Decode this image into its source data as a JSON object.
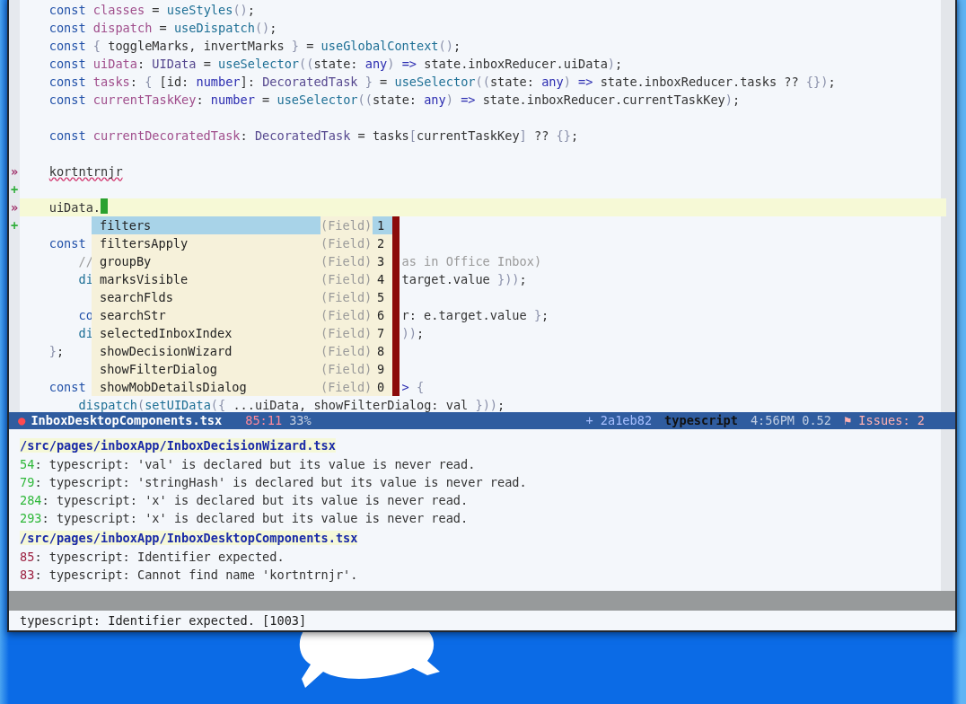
{
  "editor": {
    "lines": [
      {
        "current": false,
        "tokens": [
          {
            "kind": "kw",
            "text": "    const "
          },
          {
            "kind": "var",
            "text": "classes"
          },
          {
            "kind": "plain",
            "text": " = "
          },
          {
            "kind": "fn",
            "text": "useStyles"
          },
          {
            "kind": "punct",
            "text": "()"
          },
          {
            "kind": "plain",
            "text": ";"
          }
        ]
      },
      {
        "current": false,
        "tokens": [
          {
            "kind": "kw",
            "text": "    const "
          },
          {
            "kind": "var",
            "text": "dispatch"
          },
          {
            "kind": "plain",
            "text": " = "
          },
          {
            "kind": "fn",
            "text": "useDispatch"
          },
          {
            "kind": "punct",
            "text": "()"
          },
          {
            "kind": "plain",
            "text": ";"
          }
        ]
      },
      {
        "current": false,
        "tokens": [
          {
            "kind": "kw",
            "text": "    const "
          },
          {
            "kind": "punct",
            "text": "{"
          },
          {
            "kind": "plain",
            "text": " toggleMarks, invertMarks "
          },
          {
            "kind": "punct",
            "text": "}"
          },
          {
            "kind": "plain",
            "text": " = "
          },
          {
            "kind": "fn",
            "text": "useGlobalContext"
          },
          {
            "kind": "punct",
            "text": "()"
          },
          {
            "kind": "plain",
            "text": ";"
          }
        ]
      },
      {
        "current": false,
        "tokens": [
          {
            "kind": "kw",
            "text": "    const "
          },
          {
            "kind": "var",
            "text": "uiData"
          },
          {
            "kind": "plain",
            "text": ": "
          },
          {
            "kind": "type",
            "text": "UIData"
          },
          {
            "kind": "plain",
            "text": " = "
          },
          {
            "kind": "fn",
            "text": "useSelector"
          },
          {
            "kind": "punct",
            "text": "(("
          },
          {
            "kind": "plain",
            "text": "state: "
          },
          {
            "kind": "builtin",
            "text": "any"
          },
          {
            "kind": "punct",
            "text": ") "
          },
          {
            "kind": "builtin",
            "text": "=>"
          },
          {
            "kind": "plain",
            "text": " state.inboxReducer.uiData"
          },
          {
            "kind": "punct",
            "text": ")"
          },
          {
            "kind": "plain",
            "text": ";"
          }
        ]
      },
      {
        "current": false,
        "tokens": [
          {
            "kind": "kw",
            "text": "    const "
          },
          {
            "kind": "var",
            "text": "tasks"
          },
          {
            "kind": "plain",
            "text": ": "
          },
          {
            "kind": "punct",
            "text": "{"
          },
          {
            "kind": "plain",
            "text": " [id: "
          },
          {
            "kind": "builtin",
            "text": "number"
          },
          {
            "kind": "plain",
            "text": "]: "
          },
          {
            "kind": "type",
            "text": "DecoratedTask"
          },
          {
            "kind": "punct",
            "text": " }"
          },
          {
            "kind": "plain",
            "text": " = "
          },
          {
            "kind": "fn",
            "text": "useSelector"
          },
          {
            "kind": "punct",
            "text": "(("
          },
          {
            "kind": "plain",
            "text": "state: "
          },
          {
            "kind": "builtin",
            "text": "any"
          },
          {
            "kind": "punct",
            "text": ") "
          },
          {
            "kind": "builtin",
            "text": "=>"
          },
          {
            "kind": "plain",
            "text": " state.inboxReducer.tasks ?? "
          },
          {
            "kind": "punct",
            "text": "{})"
          },
          {
            "kind": "plain",
            "text": ";"
          }
        ]
      },
      {
        "current": false,
        "tokens": [
          {
            "kind": "kw",
            "text": "    const "
          },
          {
            "kind": "var",
            "text": "currentTaskKey"
          },
          {
            "kind": "plain",
            "text": ": "
          },
          {
            "kind": "builtin",
            "text": "number"
          },
          {
            "kind": "plain",
            "text": " = "
          },
          {
            "kind": "fn",
            "text": "useSelector"
          },
          {
            "kind": "punct",
            "text": "(("
          },
          {
            "kind": "plain",
            "text": "state: "
          },
          {
            "kind": "builtin",
            "text": "any"
          },
          {
            "kind": "punct",
            "text": ") "
          },
          {
            "kind": "builtin",
            "text": "=>"
          },
          {
            "kind": "plain",
            "text": " state.inboxReducer.currentTaskKey"
          },
          {
            "kind": "punct",
            "text": ")"
          },
          {
            "kind": "plain",
            "text": ";"
          }
        ]
      },
      {
        "current": false
      },
      {
        "current": false,
        "tokens": [
          {
            "kind": "kw",
            "text": "    const "
          },
          {
            "kind": "var",
            "text": "currentDecoratedTask"
          },
          {
            "kind": "plain",
            "text": ": "
          },
          {
            "kind": "type",
            "text": "DecoratedTask"
          },
          {
            "kind": "plain",
            "text": " = tasks"
          },
          {
            "kind": "punct",
            "text": "["
          },
          {
            "kind": "plain",
            "text": "currentTaskKey"
          },
          {
            "kind": "punct",
            "text": "]"
          },
          {
            "kind": "plain",
            "text": " ?? "
          },
          {
            "kind": "punct",
            "text": "{}"
          },
          {
            "kind": "plain",
            "text": ";"
          }
        ]
      },
      {
        "current": false
      },
      {
        "marker": "»",
        "current": false,
        "tokens": [
          {
            "kind": "error",
            "text": "    kortntrnjr"
          }
        ]
      },
      {
        "marker": "+",
        "current": false
      },
      {
        "marker": "»",
        "current": true,
        "tokens": [
          {
            "kind": "plain",
            "text": "    uiData."
          }
        ]
      },
      {
        "marker": "+",
        "current": false
      },
      {
        "current": false,
        "tokens": [
          {
            "kind": "kw",
            "text": "    const"
          }
        ]
      },
      {
        "current": false,
        "tokens": [
          {
            "kind": "comment",
            "text": "        //"
          }
        ],
        "tail": [
          {
            "kind": "comment",
            "text": "as in Office Inbox)"
          }
        ]
      },
      {
        "current": false,
        "tokens": [
          {
            "kind": "fn",
            "text": "        di"
          }
        ],
        "tail": [
          {
            "kind": "plain",
            "text": "target.value "
          },
          {
            "kind": "punct",
            "text": "}))"
          },
          {
            "kind": "plain",
            "text": ";"
          }
        ]
      },
      {
        "current": false
      },
      {
        "current": false,
        "tokens": [
          {
            "kind": "kw",
            "text": "        co"
          }
        ],
        "tail": [
          {
            "kind": "plain",
            "text": "r: e.target.value "
          },
          {
            "kind": "punct",
            "text": "}"
          },
          {
            "kind": "plain",
            "text": ";"
          }
        ]
      },
      {
        "current": false,
        "tokens": [
          {
            "kind": "fn",
            "text": "        di"
          }
        ],
        "tail": [
          {
            "kind": "punct",
            "text": "))"
          },
          {
            "kind": "plain",
            "text": ";"
          }
        ]
      },
      {
        "current": false,
        "tokens": [
          {
            "kind": "punct",
            "text": "    }"
          },
          {
            "kind": "plain",
            "text": ";"
          }
        ]
      },
      {
        "current": false
      },
      {
        "current": false,
        "tokens": [
          {
            "kind": "kw",
            "text": "    const"
          }
        ],
        "tail": [
          {
            "kind": "builtin",
            "text": ">"
          },
          {
            "kind": "punct",
            "text": " {"
          }
        ]
      },
      {
        "current": false,
        "tokens": [
          {
            "kind": "fn",
            "text": "        dispatch"
          },
          {
            "kind": "punct",
            "text": "("
          },
          {
            "kind": "fn",
            "text": "setUIData"
          },
          {
            "kind": "punct",
            "text": "({"
          },
          {
            "kind": "plain",
            "text": " ...uiData, showFilterDialog: val "
          },
          {
            "kind": "punct",
            "text": "}))"
          },
          {
            "kind": "plain",
            "text": ";"
          }
        ]
      }
    ],
    "completions": [
      {
        "label": "filters",
        "annotation": "(Field)",
        "key": "1",
        "selected": true
      },
      {
        "label": "filtersApply",
        "annotation": "(Field)",
        "key": "2",
        "selected": false
      },
      {
        "label": "groupBy",
        "annotation": "(Field)",
        "key": "3",
        "selected": false
      },
      {
        "label": "marksVisible",
        "annotation": "(Field)",
        "key": "4",
        "selected": false
      },
      {
        "label": "searchFlds",
        "annotation": "(Field)",
        "key": "5",
        "selected": false
      },
      {
        "label": "searchStr",
        "annotation": "(Field)",
        "key": "6",
        "selected": false
      },
      {
        "label": "selectedInboxIndex",
        "annotation": "(Field)",
        "key": "7",
        "selected": false
      },
      {
        "label": "showDecisionWizard",
        "annotation": "(Field)",
        "key": "8",
        "selected": false
      },
      {
        "label": "showFilterDialog",
        "annotation": "(Field)",
        "key": "9",
        "selected": false
      },
      {
        "label": "showMobDetailsDialog",
        "annotation": "(Field)",
        "key": "0",
        "selected": false
      }
    ]
  },
  "mode_line": {
    "modified": "●",
    "buffer_name": "InboxDesktopComponents.tsx",
    "position": "85:11",
    "percent": "33%",
    "vc": "+ 2a1eb82",
    "mode": "typescript",
    "time_load": "4:56PM 0.52",
    "issues": "⚑ Issues: 2"
  },
  "errors": [
    {
      "file": "/src/pages/inboxApp/InboxDecisionWizard.tsx",
      "items": [
        {
          "line": "54",
          "message": ": typescript: 'val' is declared but its value is never read.",
          "color": "#2fb83a"
        },
        {
          "line": "79",
          "message": ": typescript: 'stringHash' is declared but its value is never read.",
          "color": "#2fb83a"
        },
        {
          "line": "284",
          "message": ": typescript: 'x' is declared but its value is never read.",
          "color": "#2fb83a"
        },
        {
          "line": "293",
          "message": ": typescript: 'x' is declared but its value is never read.",
          "color": "#2fb83a"
        }
      ]
    },
    {
      "file": "/src/pages/inboxApp/InboxDesktopComponents.tsx",
      "items": [
        {
          "line": "85",
          "message": ": typescript: Identifier expected.",
          "color": "#9c2040"
        },
        {
          "line": "83",
          "message": ": typescript: Cannot find name 'kortntrnjr'.",
          "color": "#9c2040"
        }
      ]
    }
  ],
  "echo_area": "typescript: Identifier expected. [1003]"
}
